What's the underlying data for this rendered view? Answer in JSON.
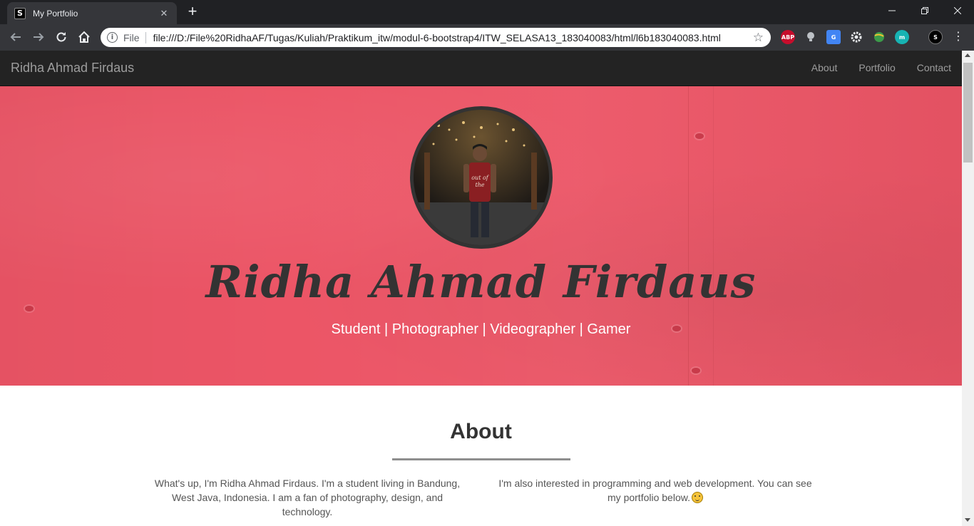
{
  "browser": {
    "tab_title": "My Portfolio",
    "tab_favicon_letter": "S",
    "new_tab_symbol": "+",
    "address": {
      "scheme_label": "File",
      "url": "file:///D:/File%20RidhaAF/Tugas/Kuliah/Praktikum_itw/modul-6-bootstrap4/ITW_SELASA13_183040083/html/l6b183040083.html"
    },
    "extensions": [
      {
        "name": "adblock-plus-icon",
        "label": "ABP",
        "color": "#c70d2c"
      },
      {
        "name": "lightbulb-extension-icon",
        "label": "",
        "color": "#5f6368"
      },
      {
        "name": "google-translate-icon",
        "label": "G",
        "color": "#4285f4"
      },
      {
        "name": "gear-extension-icon",
        "label": "",
        "color": "#9aa0a6"
      },
      {
        "name": "globe-extension-icon",
        "label": "",
        "color": "#3c9b4a"
      },
      {
        "name": "m-extension-icon",
        "label": "m",
        "color": "#17b3b3"
      },
      {
        "name": "profile-extension-icon",
        "label": "S",
        "color": "#000000"
      }
    ]
  },
  "site": {
    "brand": "Ridha Ahmad Firdaus",
    "nav": [
      {
        "label": "About"
      },
      {
        "label": "Portfolio"
      },
      {
        "label": "Contact"
      }
    ],
    "hero": {
      "name": "Ridha Ahmad Firdaus",
      "subtitle": "Student | Photographer | Videographer | Gamer",
      "background_color": "#ec5566"
    },
    "about": {
      "title": "About",
      "left_text": "What's up, I'm Ridha Ahmad Firdaus. I'm a student living in Bandung, West Java, Indonesia. I am a fan of photography, design, and technology.",
      "right_text": "I'm also interested in programming and web development. You can see my portfolio below."
    }
  }
}
